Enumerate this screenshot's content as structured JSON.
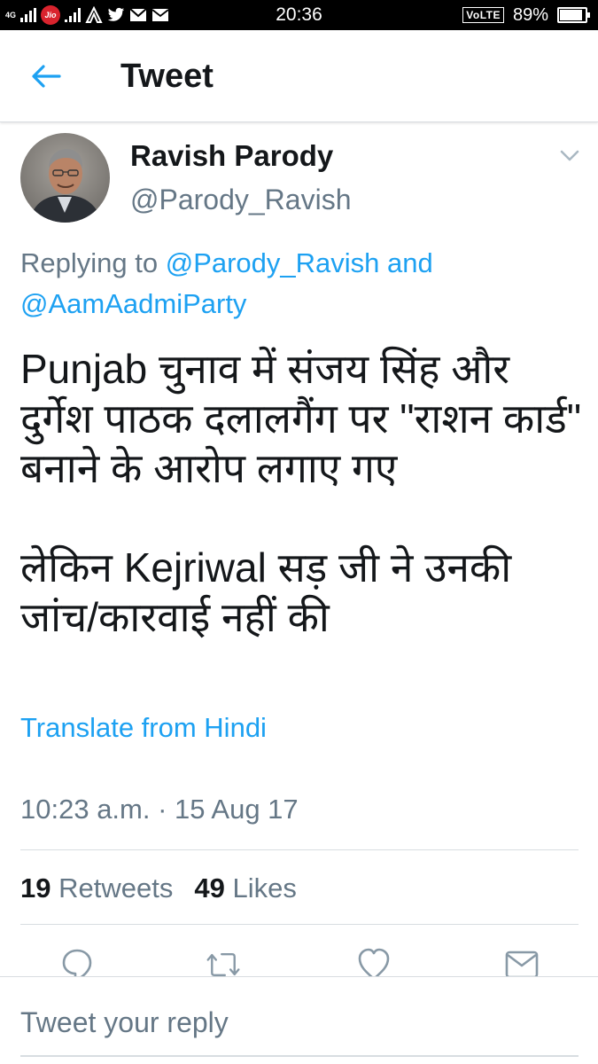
{
  "status_bar": {
    "network": "4G",
    "carrier_badge": "Jio",
    "time": "20:36",
    "volte": "VoLTE",
    "battery_percent": "89%",
    "battery_level": 0.89
  },
  "header": {
    "title": "Tweet"
  },
  "tweet": {
    "author_name": "Ravish Parody",
    "author_handle": "@Parody_Ravish",
    "replying_prefix": "Replying to",
    "replying_mention_1": "@Parody_Ravish",
    "replying_and": "and",
    "replying_mention_2": "@AamAadmiParty",
    "text_para_1": "Punjab चुनाव में संजय सिंह और दुर्गेश पाठक दलालगैंग पर \"राशन कार्ड\" बनाने के आरोप लगाए गए",
    "text_para_2": "लेकिन Kejriwal सड़ जी ने उनकी जांच/कारवाई नहीं की",
    "translate_label": "Translate from Hindi",
    "timestamp": "10:23 a.m. · 15 Aug 17",
    "retweet_count": "19",
    "retweet_label": "Retweets",
    "like_count": "49",
    "like_label": "Likes"
  },
  "reply": {
    "placeholder": "Tweet your reply"
  },
  "icons": {
    "back": "arrow-left-icon",
    "caret": "chevron-down-icon",
    "reply": "reply-icon",
    "retweet": "retweet-icon",
    "like": "heart-icon",
    "dm": "envelope-icon"
  },
  "colors": {
    "accent": "#1da1f2",
    "secondary_text": "#657786",
    "primary_text": "#14171a"
  }
}
